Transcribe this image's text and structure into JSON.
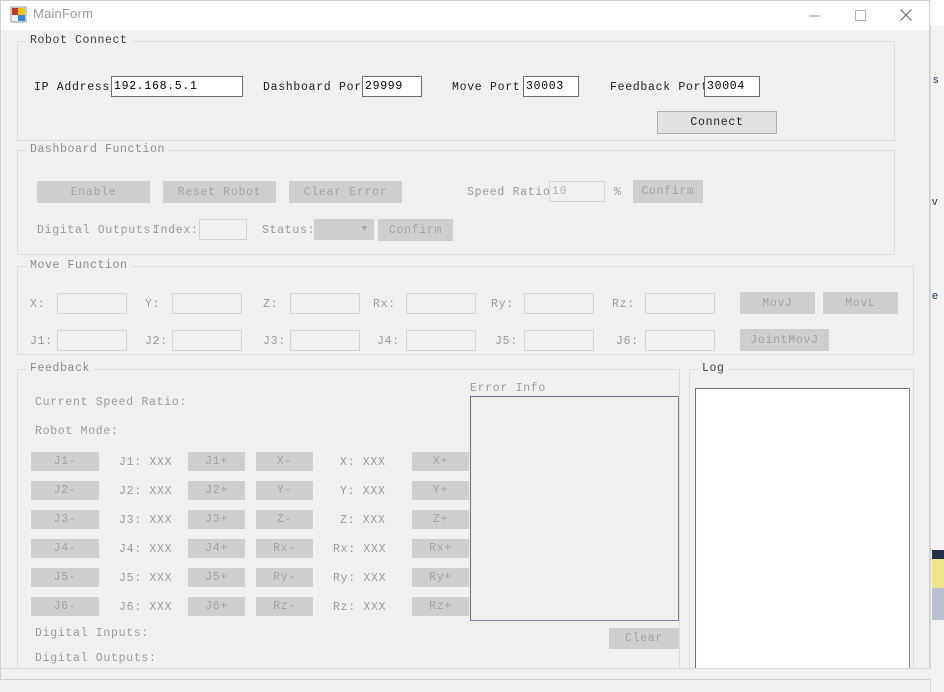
{
  "window": {
    "title": "MainForm",
    "icon": "winforms-icon",
    "minimize_label": "—",
    "maximize_label": "☐",
    "close_label": "✕"
  },
  "robot_connect": {
    "title": "Robot Connect",
    "ip_label": "IP Address:",
    "ip_value": "192.168.5.1",
    "dashboard_label": "Dashboard Port:",
    "dashboard_value": "29999",
    "move_label": "Move Port:",
    "move_value": "30003",
    "feedback_label": "Feedback Port:",
    "feedback_value": "30004",
    "connect_label": "Connect"
  },
  "dashboard_function": {
    "title": "Dashboard Function",
    "enable_label": "Enable",
    "reset_label": "Reset Robot",
    "clear_error_label": "Clear Error",
    "speed_ratio_label": "Speed Ratio:",
    "speed_ratio_value": "10",
    "percent_label": "%",
    "confirm_speed_label": "Confirm",
    "digital_outputs_label": "Digital Outputs:",
    "index_label": "Index:",
    "index_value": "",
    "status_label": "Status:",
    "status_value": "",
    "confirm_do_label": "Confirm"
  },
  "move_function": {
    "title": "Move Function",
    "cartesian": [
      {
        "label": "X:",
        "value": ""
      },
      {
        "label": "Y:",
        "value": ""
      },
      {
        "label": "Z:",
        "value": ""
      },
      {
        "label": "Rx:",
        "value": ""
      },
      {
        "label": "Ry:",
        "value": ""
      },
      {
        "label": "Rz:",
        "value": ""
      }
    ],
    "joints": [
      {
        "label": "J1:",
        "value": ""
      },
      {
        "label": "J2:",
        "value": ""
      },
      {
        "label": "J3:",
        "value": ""
      },
      {
        "label": "J4:",
        "value": ""
      },
      {
        "label": "J5:",
        "value": ""
      },
      {
        "label": "J6:",
        "value": ""
      }
    ],
    "movj_label": "MovJ",
    "movl_label": "MovL",
    "jointmovj_label": "JointMovJ"
  },
  "feedback": {
    "title": "Feedback",
    "current_speed_ratio_label": "Current Speed Ratio:",
    "current_speed_ratio_value": "",
    "robot_mode_label": "Robot Mode:",
    "robot_mode_value": "",
    "digital_inputs_label": "Digital Inputs:",
    "digital_inputs_value": "",
    "digital_outputs_label": "Digital Outputs:",
    "digital_outputs_value": "",
    "jog_rows": [
      {
        "joint_minus": "J1-",
        "joint_readout": "J1: XXX",
        "joint_plus": "J1+",
        "cart_minus": "X-",
        "cart_readout": "X: XXX",
        "cart_plus": "X+"
      },
      {
        "joint_minus": "J2-",
        "joint_readout": "J2: XXX",
        "joint_plus": "J2+",
        "cart_minus": "Y-",
        "cart_readout": "Y: XXX",
        "cart_plus": "Y+"
      },
      {
        "joint_minus": "J3-",
        "joint_readout": "J3: XXX",
        "joint_plus": "J3+",
        "cart_minus": "Z-",
        "cart_readout": "Z: XXX",
        "cart_plus": "Z+"
      },
      {
        "joint_minus": "J4-",
        "joint_readout": "J4: XXX",
        "joint_plus": "J4+",
        "cart_minus": "Rx-",
        "cart_readout": "Rx: XXX",
        "cart_plus": "Rx+"
      },
      {
        "joint_minus": "J5-",
        "joint_readout": "J5: XXX",
        "joint_plus": "J5+",
        "cart_minus": "Ry-",
        "cart_readout": "Ry: XXX",
        "cart_plus": "Ry+"
      },
      {
        "joint_minus": "J6-",
        "joint_readout": "J6: XXX",
        "joint_plus": "J6+",
        "cart_minus": "Rz-",
        "cart_readout": "Rz: XXX",
        "cart_plus": "Rz+"
      }
    ],
    "error_info_label": "Error Info",
    "error_info_value": "",
    "clear_label": "Clear"
  },
  "log": {
    "title": "Log",
    "value": ""
  },
  "colors": {
    "form_background": "#f0f0f0",
    "titlebar": "#ffffff",
    "disabled_button": "#cfcfcf",
    "disabled_text": "#a2a2a2",
    "enabled_button": "#e1e1e1",
    "label_disabled": "#9b9b9b",
    "textbox_border": "#6f6f6f"
  }
}
